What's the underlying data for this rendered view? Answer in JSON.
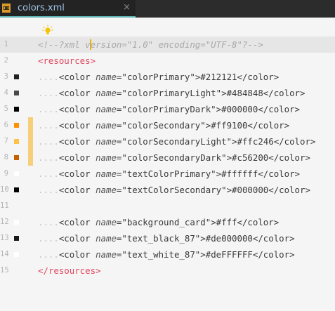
{
  "tab": {
    "title": "colors.xml",
    "close": "×"
  },
  "lines": [
    {
      "n": "1",
      "kind": "comment",
      "text": "<!--?xml version=\"1.0\" encoding=\"UTF-8\"?-->"
    },
    {
      "n": "2",
      "kind": "open",
      "text": "resources"
    },
    {
      "n": "3",
      "kind": "color",
      "name": "colorPrimary",
      "value": "#212121",
      "swatch": "#212121"
    },
    {
      "n": "4",
      "kind": "color",
      "name": "colorPrimaryLight",
      "value": "#484848",
      "swatch": "#484848"
    },
    {
      "n": "5",
      "kind": "color",
      "name": "colorPrimaryDark",
      "value": "#000000",
      "swatch": "#000000"
    },
    {
      "n": "6",
      "kind": "color",
      "name": "colorSecondary",
      "value": "#ff9100",
      "swatch": "#ff9100",
      "changed": true
    },
    {
      "n": "7",
      "kind": "color",
      "name": "colorSecondaryLight",
      "value": "#ffc246",
      "swatch": "#ffc246",
      "changed": true
    },
    {
      "n": "8",
      "kind": "color",
      "name": "colorSecondaryDark",
      "value": "#c56200",
      "swatch": "#c56200",
      "changed": true
    },
    {
      "n": "9",
      "kind": "color",
      "name": "textColorPrimary",
      "value": "#ffffff",
      "swatch": "#ffffff"
    },
    {
      "n": "10",
      "kind": "color",
      "name": "textColorSecondary",
      "value": "#000000",
      "swatch": "#000000"
    },
    {
      "n": "11",
      "kind": "blank"
    },
    {
      "n": "12",
      "kind": "color",
      "name": "background_card",
      "value": "#fff",
      "swatch": "#ffffff"
    },
    {
      "n": "13",
      "kind": "color",
      "name": "text_black_87",
      "value": "#de000000",
      "swatch": "#1a1a1a"
    },
    {
      "n": "14",
      "kind": "color",
      "name": "text_white_87",
      "value": "#deFFFFFF",
      "swatch": "#ffffff"
    },
    {
      "n": "15",
      "kind": "close",
      "text": "resources"
    }
  ],
  "tokens": {
    "indent": "....",
    "element": "color",
    "attribute": "name"
  },
  "colors": {
    "tag": "#e0465d",
    "tab_underline": "#5fb3b3",
    "change_marker": "#f7ce7a",
    "caret": "#f0b100"
  }
}
